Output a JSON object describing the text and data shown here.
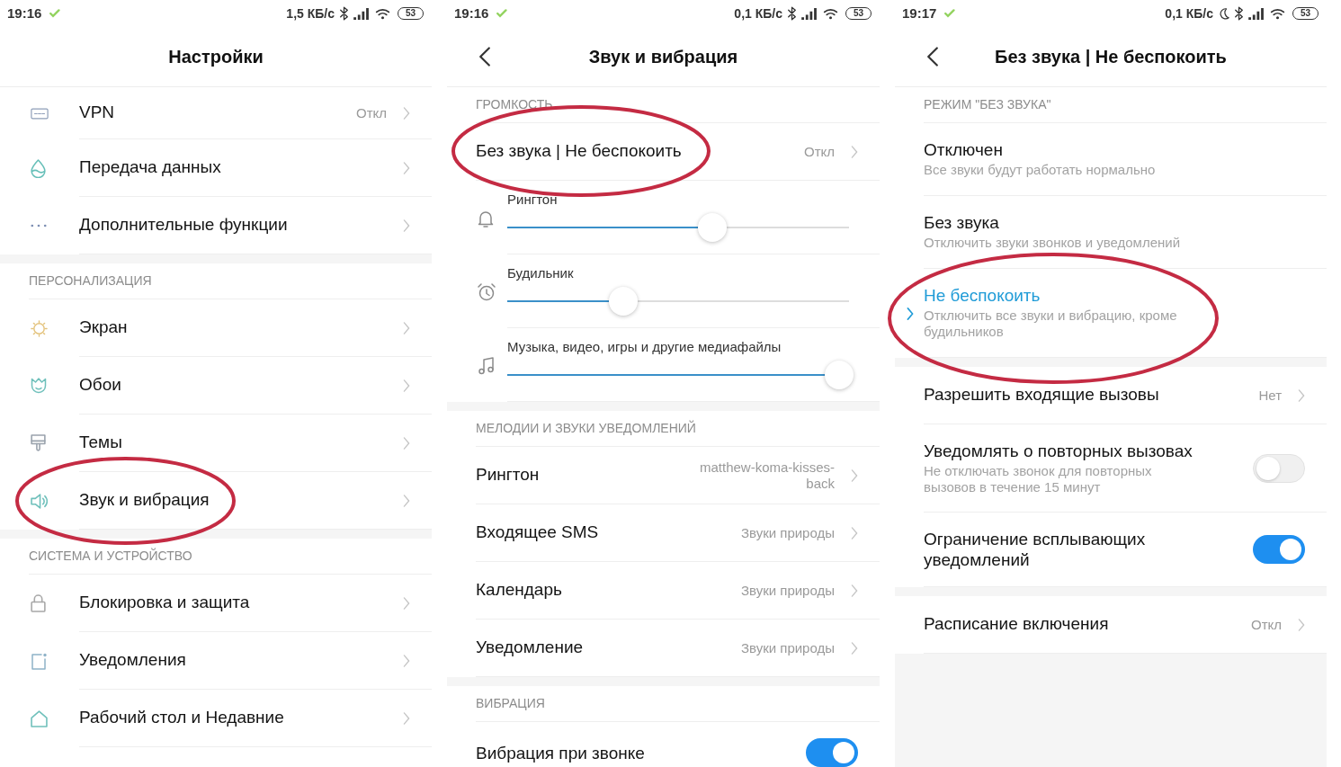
{
  "screens": [
    {
      "status_bar": {
        "time": "19:16",
        "speed": "1,5 КБ/с",
        "battery": "53",
        "dnd": false
      },
      "title": "Настройки",
      "back": false,
      "sections": [
        {
          "items": [
            {
              "kind": "link",
              "label": "VPN",
              "value": "Откл",
              "circled": false
            },
            {
              "kind": "link",
              "label": "Передача данных",
              "circled": false
            },
            {
              "kind": "link",
              "label": "Дополнительные функции",
              "circled": false
            }
          ]
        },
        {
          "header": "ПЕРСОНАЛИЗАЦИЯ",
          "items": [
            {
              "kind": "link",
              "label": "Экран",
              "circled": false
            },
            {
              "kind": "link",
              "label": "Обои",
              "circled": false
            },
            {
              "kind": "link",
              "label": "Темы",
              "circled": false
            },
            {
              "kind": "link",
              "label": "Звук и вибрация",
              "circled": true
            }
          ]
        },
        {
          "header": "СИСТЕМА И УСТРОЙСТВО",
          "items": [
            {
              "kind": "link",
              "label": "Блокировка и защита",
              "circled": false
            },
            {
              "kind": "link",
              "label": "Уведомления",
              "circled": false
            },
            {
              "kind": "link",
              "label": "Рабочий стол и Недавние",
              "circled": false
            }
          ]
        }
      ]
    },
    {
      "status_bar": {
        "time": "19:16",
        "speed": "0,1 КБ/с",
        "battery": "53",
        "dnd": false
      },
      "title": "Звук и вибрация",
      "back": true,
      "sections": [
        {
          "header": "ГРОМКОСТЬ",
          "items": [
            {
              "kind": "link",
              "label": "Без звука | Не беспокоить",
              "value": "Откл",
              "circled": true
            },
            {
              "kind": "slider",
              "label": "Рингтон",
              "level": 0.6,
              "circled": false
            },
            {
              "kind": "slider",
              "label": "Будильник",
              "level": 0.34,
              "circled": false
            },
            {
              "kind": "slider",
              "label": "Музыка, видео, игры и другие медиафайлы",
              "level": 0.97,
              "circled": false
            }
          ]
        },
        {
          "header": "МЕЛОДИИ И ЗВУКИ УВЕДОМЛЕНИЙ",
          "items": [
            {
              "kind": "link",
              "label": "Рингтон",
              "value": "matthew-koma-kisses-back",
              "circled": false
            },
            {
              "kind": "link",
              "label": "Входящее SMS",
              "value": "Звуки природы",
              "circled": false
            },
            {
              "kind": "link",
              "label": "Календарь",
              "value": "Звуки природы",
              "circled": false
            },
            {
              "kind": "link",
              "label": "Уведомление",
              "value": "Звуки природы",
              "circled": false
            }
          ]
        },
        {
          "header": "ВИБРАЦИЯ",
          "items": [
            {
              "kind": "toggle",
              "label": "Вибрация при звонке",
              "on": true,
              "circled": false
            }
          ]
        }
      ]
    },
    {
      "status_bar": {
        "time": "19:17",
        "speed": "0,1 КБ/с",
        "battery": "53",
        "dnd": true
      },
      "title": "Без звука | Не беспокоить",
      "back": true,
      "sections": [
        {
          "header": "РЕЖИМ \"БЕЗ ЗВУКА\"",
          "items": [
            {
              "kind": "option",
              "label": "Отключен",
              "description": "Все звуки будут работать нормально",
              "selected": false,
              "circled": false
            },
            {
              "kind": "option",
              "label": "Без звука",
              "description": "Отключить звуки звонков и уведомлений",
              "selected": false,
              "circled": false
            },
            {
              "kind": "option",
              "label": "Не беспокоить",
              "description": "Отключить все звуки и вибрацию, кроме будильников",
              "selected": true,
              "circled": true
            }
          ]
        },
        {
          "items": [
            {
              "kind": "link",
              "label": "Разрешить входящие вызовы",
              "value": "Нет",
              "circled": false
            },
            {
              "kind": "toggle",
              "label": "Уведомлять о повторных вызовах",
              "description": "Не отключать звонок для повторных вызовов в течение 15 минут",
              "on": false,
              "circled": false
            },
            {
              "kind": "toggle",
              "label": "Ограничение всплывающих уведомлений",
              "on": true,
              "circled": false
            }
          ]
        },
        {
          "items": [
            {
              "kind": "link",
              "label": "Расписание включения",
              "value": "Откл",
              "circled": false
            }
          ]
        }
      ]
    }
  ]
}
